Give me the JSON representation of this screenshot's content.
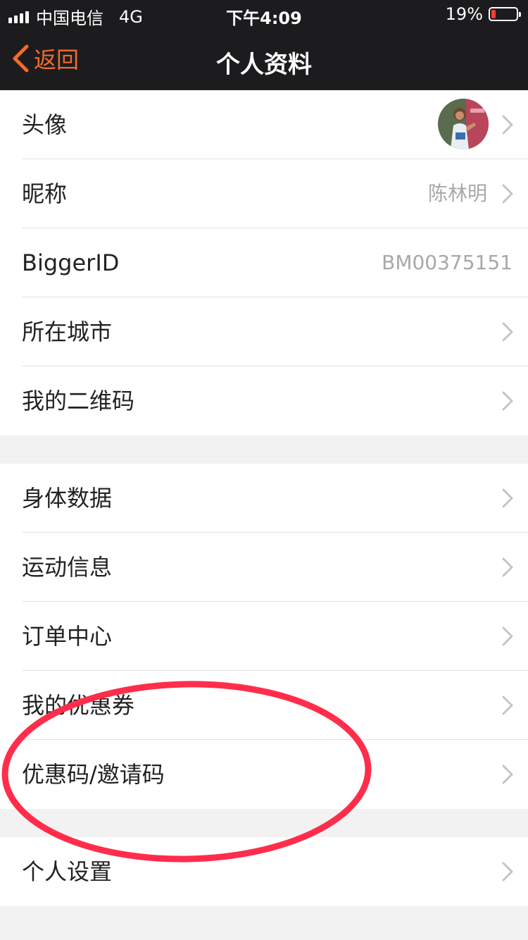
{
  "status_bar": {
    "carrier": "中国电信",
    "network": "4G",
    "time": "下午4:09",
    "battery": "19%",
    "battery_level": 0.19
  },
  "nav": {
    "back_label": "返回",
    "title": "个人资料"
  },
  "groups": [
    {
      "items": [
        {
          "label": "头像",
          "value": "",
          "avatar": true,
          "chevron": true
        },
        {
          "label": "昵称",
          "value": "陈林明",
          "chevron": true
        },
        {
          "label": "BiggerID",
          "value": "BM00375151",
          "chevron": false
        },
        {
          "label": "所在城市",
          "value": "",
          "chevron": true
        },
        {
          "label": "我的二维码",
          "value": "",
          "chevron": true
        }
      ]
    },
    {
      "items": [
        {
          "label": "身体数据",
          "value": "",
          "chevron": true
        },
        {
          "label": "运动信息",
          "value": "",
          "chevron": true
        },
        {
          "label": "订单中心",
          "value": "",
          "chevron": true
        },
        {
          "label": "我的优惠券",
          "value": "",
          "chevron": true
        },
        {
          "label": "优惠码/邀请码",
          "value": "",
          "chevron": true
        }
      ]
    },
    {
      "items": [
        {
          "label": "个人设置",
          "value": "",
          "chevron": true
        }
      ]
    }
  ],
  "colors": {
    "accent": "#f26b2e",
    "annotation": "#ff2d4b",
    "bar_background": "#1c1c1e"
  }
}
